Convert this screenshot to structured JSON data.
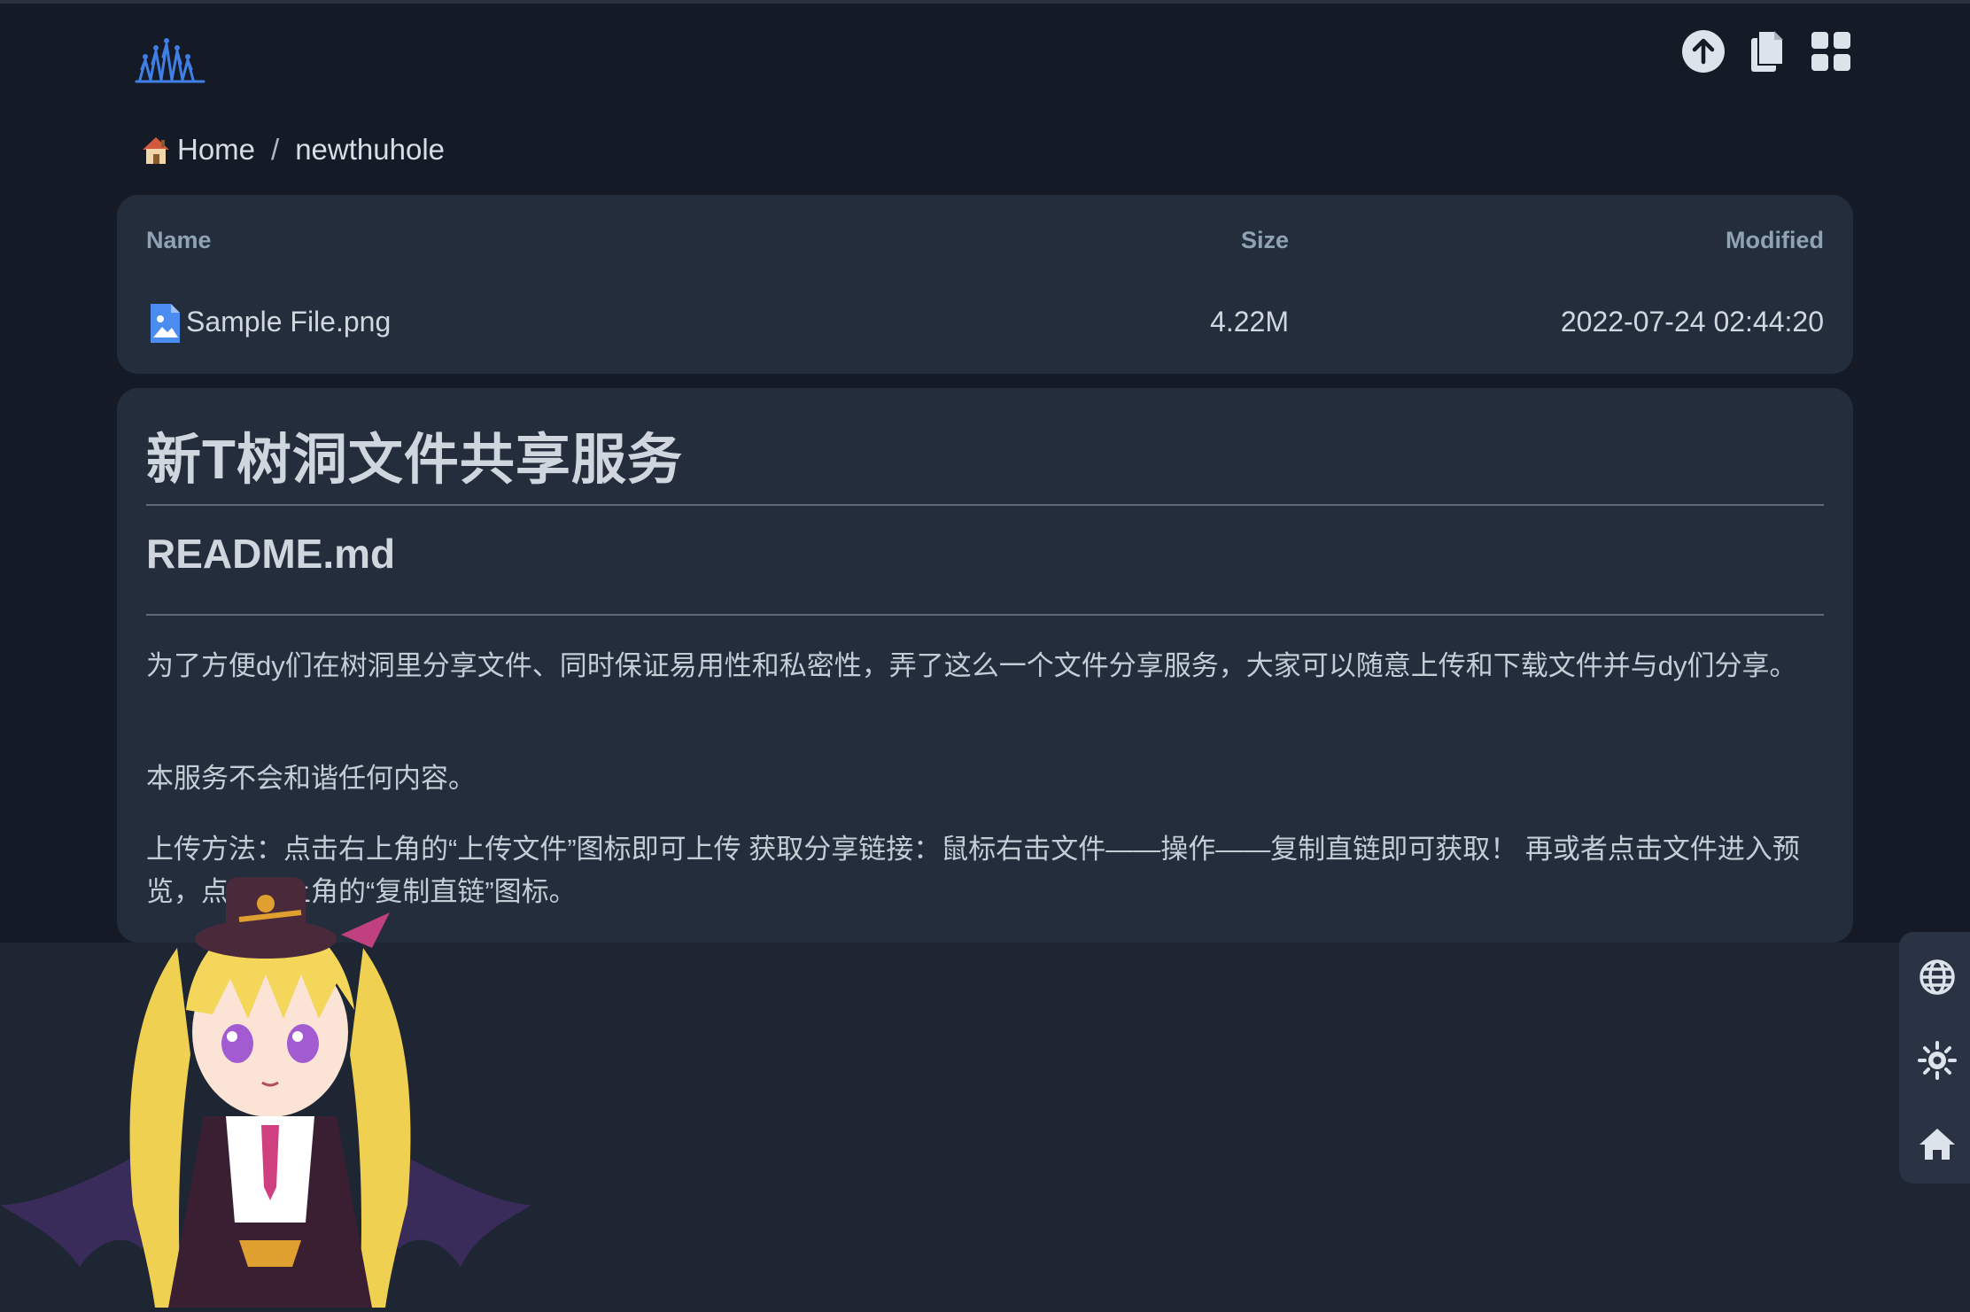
{
  "breadcrumb": {
    "home_icon": "house-emoji",
    "home_label": "Home",
    "separator": "/",
    "current": "newthuhole"
  },
  "toolbar": {
    "icons": [
      "upload-icon",
      "copy-icon",
      "grid-view-icon"
    ]
  },
  "file_table": {
    "columns": {
      "name": "Name",
      "size": "Size",
      "modified": "Modified"
    },
    "rows": [
      {
        "icon": "image-file-icon",
        "name": "Sample File.png",
        "size": "4.22M",
        "modified": "2022-07-24 02:44:20"
      }
    ]
  },
  "readme": {
    "title": "新T树洞文件共享服务",
    "subtitle": "README.md",
    "paragraphs": [
      "为了方便dy们在树洞里分享文件、同时保证易用性和私密性，弄了这么一个文件分享服务，大家可以随意上传和下载文件并与dy们分享。",
      "本服务不会和谐任何内容。",
      "上传方法：点击右上角的“上传文件”图标即可上传 获取分享链接：鼠标右击文件——操作——复制直链即可获取！ 再或者点击文件进入预览，点击右上角的“复制直链”图标。"
    ]
  },
  "side_panel": {
    "icons": [
      "globe-icon",
      "theme-sun-icon",
      "home-icon"
    ]
  },
  "colors": {
    "background": "#1e2633",
    "header_band": "#141b27",
    "card": "#232d3c",
    "accent_blue": "#4a8cf0"
  }
}
